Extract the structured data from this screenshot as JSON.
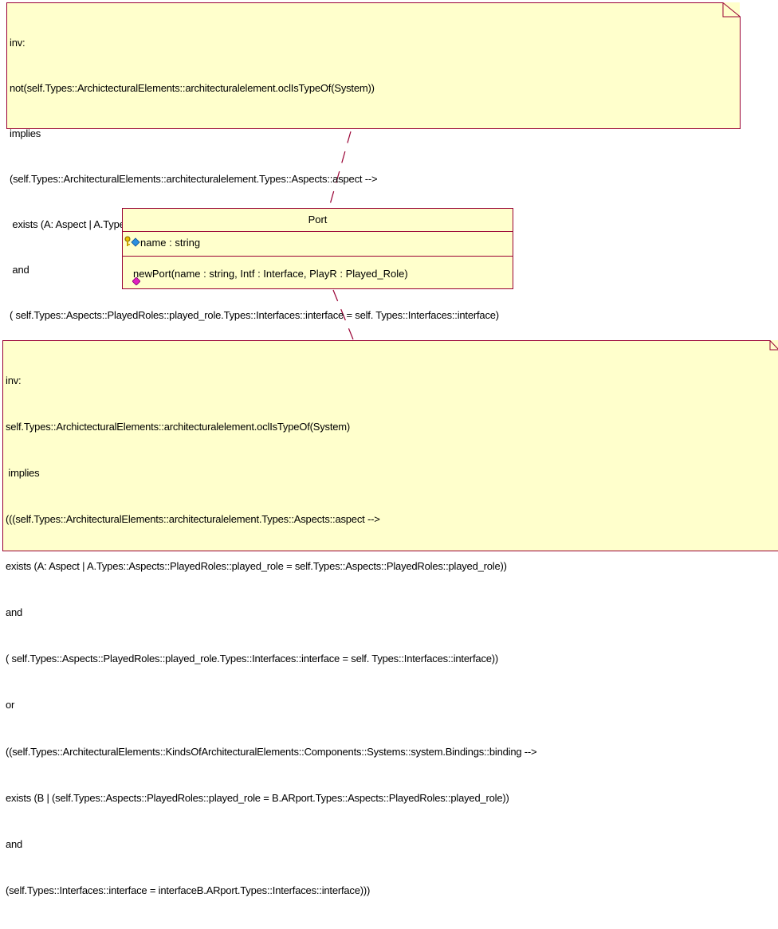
{
  "top_note": {
    "lines": [
      "inv:",
      "not(self.Types::ArchictecturalElements::architecturalelement.oclIsTypeOf(System))",
      "implies",
      "(self.Types::ArchitecturalElements::architecturalelement.Types::Aspects::aspect -->",
      " exists (A: Aspect | A.Types::Aspects::PlayedRoles::played_role = self.Types::Aspects::PlayedRoles::played_role)",
      " and",
      "( self.Types::Aspects::PlayedRoles::played_role.Types::Interfaces::interface = self. Types::Interfaces::interface)"
    ]
  },
  "port_class": {
    "name": "Port",
    "attribute": "name : string",
    "operation": "newPort(name : string, Intf : Interface, PlayR : Played_Role)",
    "attribute_icon": "key-attribute-icon",
    "operation_icon": "operation-diamond-icon"
  },
  "bottom_note": {
    "lines": [
      "inv:",
      "self.Types::ArchictecturalElements::architecturalelement.oclIsTypeOf(System)",
      " implies",
      "(((self.Types::ArchitecturalElements::architecturalelement.Types::Aspects::aspect -->",
      "exists (A: Aspect | A.Types::Aspects::PlayedRoles::played_role = self.Types::Aspects::PlayedRoles::played_role))",
      "and",
      "( self.Types::Aspects::PlayedRoles::played_role.Types::Interfaces::interface = self. Types::Interfaces::interface))",
      "or",
      "((self.Types::ArchitecturalElements::KindsOfArchitecturalElements::Components::Systems::system.Bindings::binding -->",
      "exists (B | (self.Types::Aspects::PlayedRoles::played_role = B.ARport.Types::Aspects::PlayedRoles::played_role))",
      "and",
      "(self.Types::Interfaces::interface = interfaceB.ARport.Types::Interfaces::interface)))"
    ]
  },
  "colors": {
    "note_fill": "#ffffcc",
    "border": "#990033",
    "link": "#990033"
  }
}
